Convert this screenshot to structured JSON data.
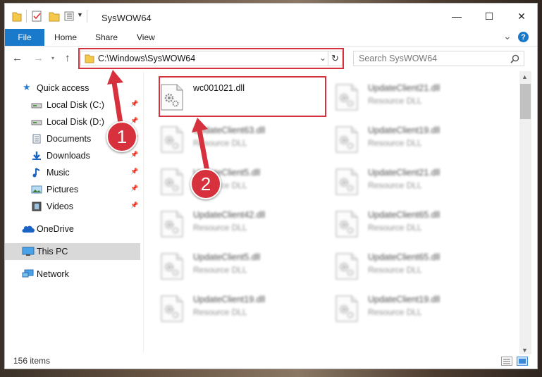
{
  "window": {
    "title": "SysWOW64",
    "minimize": "—",
    "maximize": "☐",
    "close": "✕"
  },
  "ribbon": {
    "tabs": [
      "File",
      "Home",
      "Share",
      "View"
    ],
    "expand": "⌄",
    "help": "?"
  },
  "address": {
    "path": "C:\\Windows\\SysWOW64",
    "search_placeholder": "Search SysWOW64"
  },
  "nav": {
    "quick_access": "Quick access",
    "items": [
      {
        "label": "Local Disk (C:)",
        "icon": "drive-icon",
        "pinned": true
      },
      {
        "label": "Local Disk (D:)",
        "icon": "drive-icon",
        "pinned": true
      },
      {
        "label": "Documents",
        "icon": "documents-icon",
        "pinned": true
      },
      {
        "label": "Downloads",
        "icon": "downloads-icon",
        "pinned": true
      },
      {
        "label": "Music",
        "icon": "music-icon",
        "pinned": true
      },
      {
        "label": "Pictures",
        "icon": "pictures-icon",
        "pinned": true
      },
      {
        "label": "Videos",
        "icon": "videos-icon",
        "pinned": true
      }
    ],
    "onedrive": "OneDrive",
    "this_pc": "This PC",
    "network": "Network"
  },
  "files": [
    {
      "name": "wc001021.dll",
      "type": ""
    },
    {
      "name": "UpdateClient21.dll",
      "type": "Resource DLL"
    },
    {
      "name": "UpdateClient63.dll",
      "type": "Resource DLL"
    },
    {
      "name": "UpdateClient19.dll",
      "type": "Resource DLL"
    },
    {
      "name": "UpdateClient5.dll",
      "type": "Resource DLL"
    },
    {
      "name": "UpdateClient21.dll",
      "type": "Resource DLL"
    },
    {
      "name": "UpdateClient42.dll",
      "type": "Resource DLL"
    },
    {
      "name": "UpdateClient65.dll",
      "type": "Resource DLL"
    },
    {
      "name": "UpdateClient5.dll",
      "type": "Resource DLL"
    },
    {
      "name": "UpdateClient65.dll",
      "type": "Resource DLL"
    },
    {
      "name": "UpdateClient19.dll",
      "type": "Resource DLL"
    },
    {
      "name": "UpdateClient19.dll",
      "type": "Resource DLL"
    }
  ],
  "status": {
    "item_count": "156 items"
  },
  "annotations": {
    "step1": "1",
    "step2": "2",
    "accent": "#d6313c"
  },
  "colors": {
    "file_tab": "#1979ca",
    "selected_nav": "#d9d9d9"
  }
}
